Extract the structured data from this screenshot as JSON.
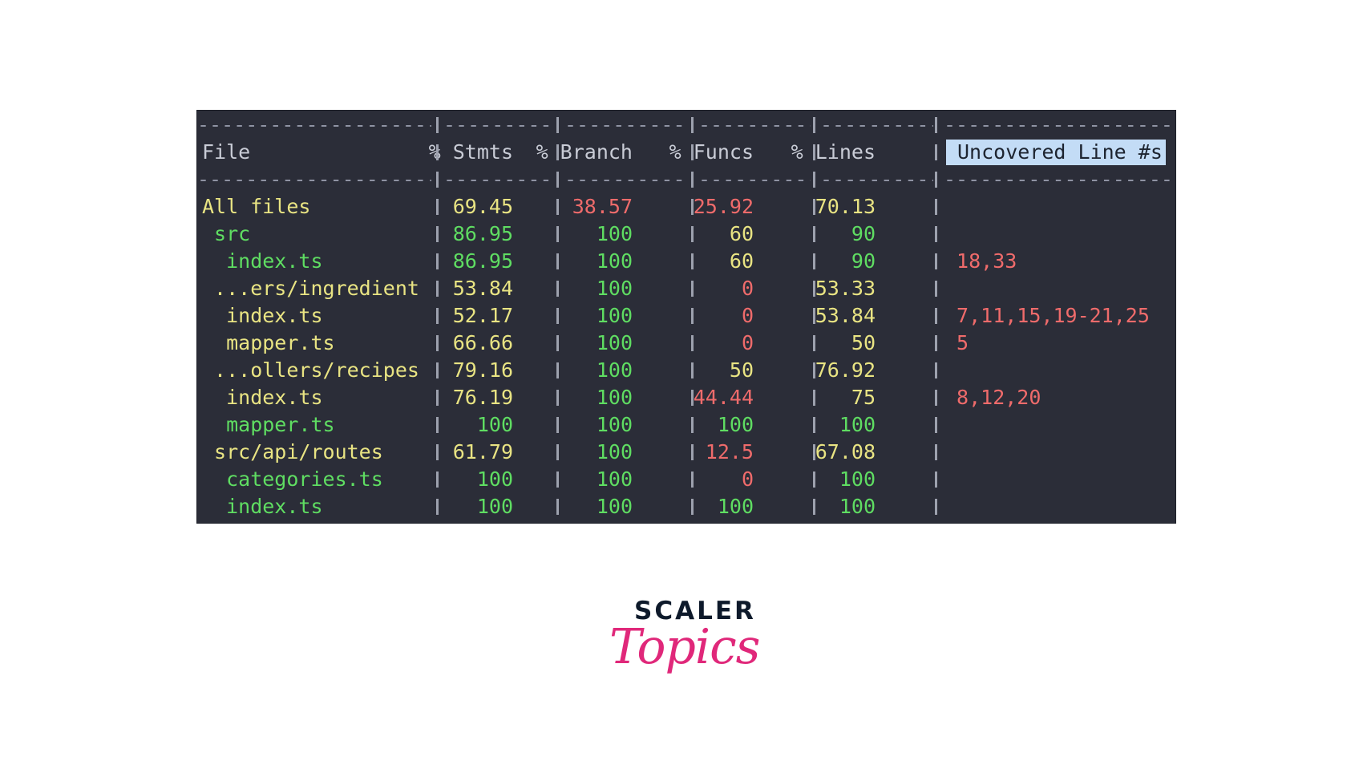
{
  "terminal": {
    "separator_char": "-",
    "headers": {
      "file": "File",
      "stmts": "% Stmts",
      "branch": "% Branch",
      "funcs": "% Funcs",
      "lines": "% Lines",
      "uncovered": "Uncovered Line #s"
    },
    "rows": [
      {
        "file": "All files",
        "stmts": "69.45",
        "branch": "38.57",
        "funcs": "25.92",
        "lines": "70.13",
        "uncovered": ""
      },
      {
        "file": " src",
        "stmts": "86.95",
        "branch": "100",
        "funcs": "60",
        "lines": "90",
        "uncovered": ""
      },
      {
        "file": "  index.ts",
        "stmts": "86.95",
        "branch": "100",
        "funcs": "60",
        "lines": "90",
        "uncovered": "18,33"
      },
      {
        "file": " ...ers/ingredient",
        "stmts": "53.84",
        "branch": "100",
        "funcs": "0",
        "lines": "53.33",
        "uncovered": ""
      },
      {
        "file": "  index.ts",
        "stmts": "52.17",
        "branch": "100",
        "funcs": "0",
        "lines": "53.84",
        "uncovered": "7,11,15,19-21,25"
      },
      {
        "file": "  mapper.ts",
        "stmts": "66.66",
        "branch": "100",
        "funcs": "0",
        "lines": "50",
        "uncovered": "5"
      },
      {
        "file": " ...ollers/recipes",
        "stmts": "79.16",
        "branch": "100",
        "funcs": "50",
        "lines": "76.92",
        "uncovered": ""
      },
      {
        "file": "  index.ts",
        "stmts": "76.19",
        "branch": "100",
        "funcs": "44.44",
        "lines": "75",
        "uncovered": "8,12,20"
      },
      {
        "file": "  mapper.ts",
        "stmts": "100",
        "branch": "100",
        "funcs": "100",
        "lines": "100",
        "uncovered": ""
      },
      {
        "file": " src/api/routes",
        "stmts": "61.79",
        "branch": "100",
        "funcs": "12.5",
        "lines": "67.08",
        "uncovered": ""
      },
      {
        "file": "  categories.ts",
        "stmts": "100",
        "branch": "100",
        "funcs": "0",
        "lines": "100",
        "uncovered": ""
      },
      {
        "file": "  index.ts",
        "stmts": "100",
        "branch": "100",
        "funcs": "100",
        "lines": "100",
        "uncovered": ""
      }
    ],
    "colors": {
      "background": "#2b2d38",
      "high": "#5fdd62",
      "medium": "#e9e483",
      "low": "#ef6b6b",
      "header_highlight": "#c3dcf6"
    }
  },
  "logo": {
    "line1": "SCALER",
    "line2": "Topics"
  }
}
